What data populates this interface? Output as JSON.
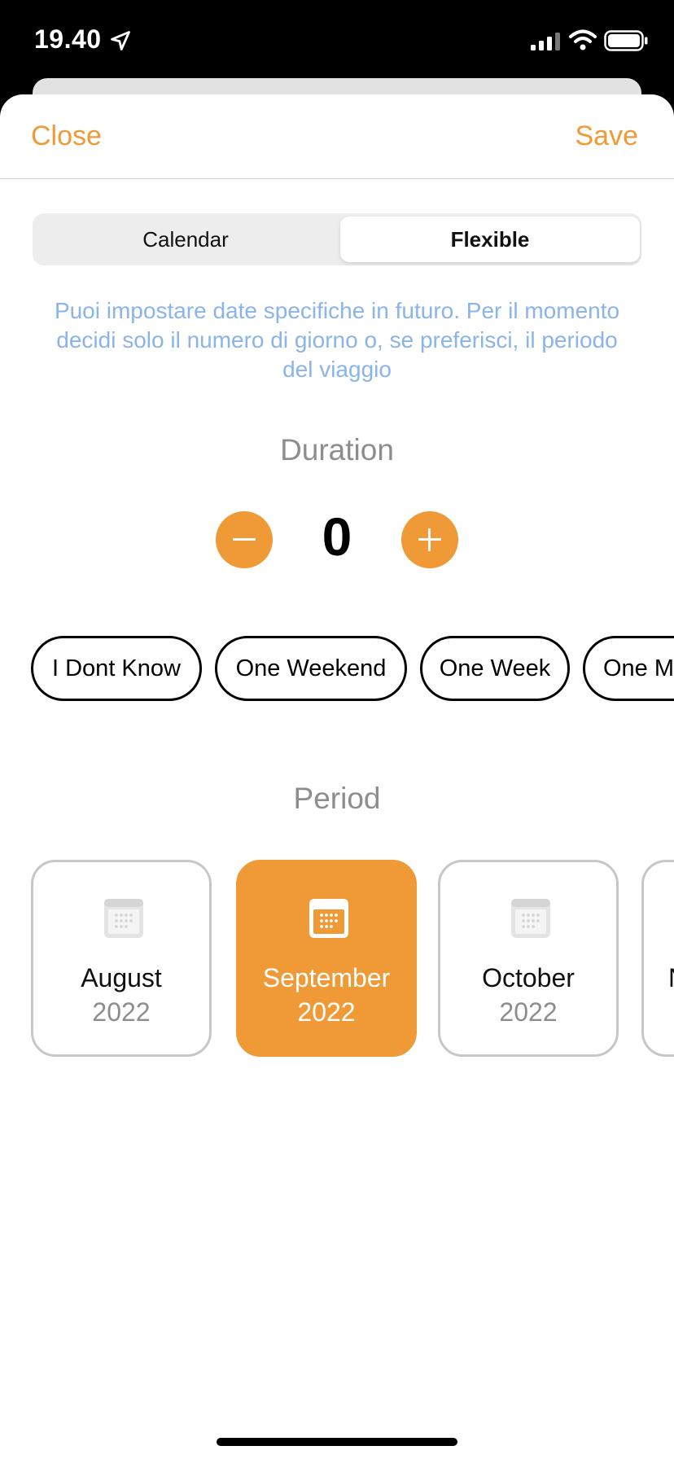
{
  "status_bar": {
    "time": "19.40",
    "icons": [
      "location-arrow-icon",
      "cellular-signal-icon",
      "wifi-icon",
      "battery-icon"
    ]
  },
  "nav": {
    "close_label": "Close",
    "save_label": "Save"
  },
  "segmented": {
    "options": [
      "Calendar",
      "Flexible"
    ],
    "selected": "Flexible"
  },
  "info_text": "Puoi impostare date specifiche in futuro. Per il momento decidi solo il numero di giorno o, se preferisci, il periodo del viaggio",
  "duration": {
    "title": "Duration",
    "value": "0",
    "presets": [
      "I Dont Know",
      "One Weekend",
      "One Week",
      "One M"
    ]
  },
  "period": {
    "title": "Period",
    "months": [
      {
        "name": "August",
        "year": "2022",
        "selected": false
      },
      {
        "name": "September",
        "year": "2022",
        "selected": true
      },
      {
        "name": "October",
        "year": "2022",
        "selected": false
      },
      {
        "name": "N",
        "year": "",
        "selected": false
      }
    ]
  },
  "colors": {
    "accent": "#f09a37",
    "info_text": "#8ab4ea",
    "muted_text": "#8d8d8d",
    "card_border": "#c7c7c7"
  }
}
